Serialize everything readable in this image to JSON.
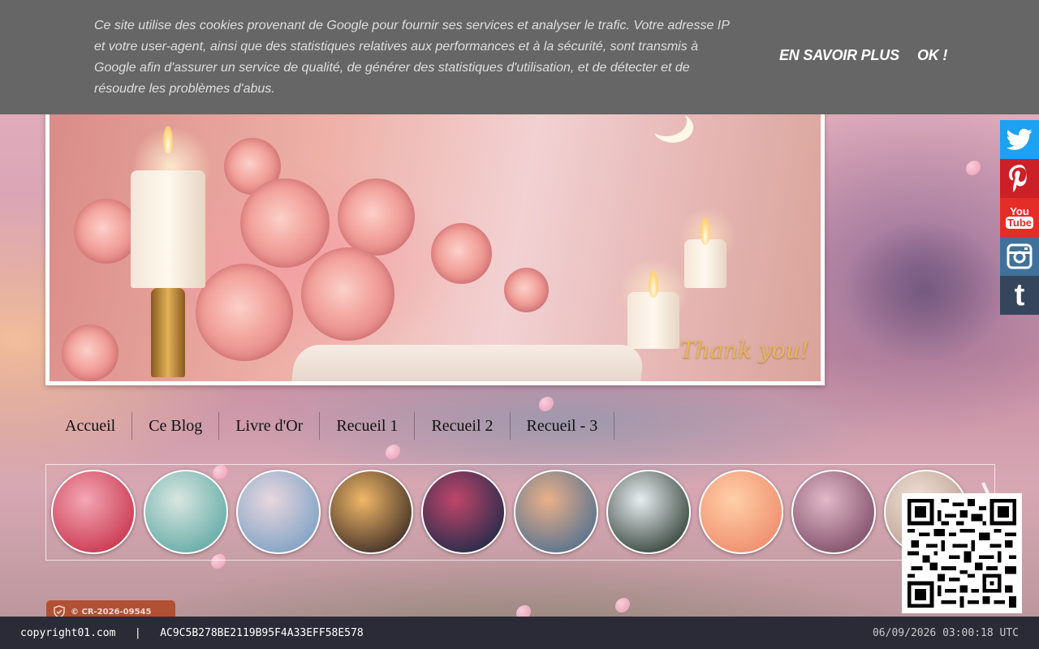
{
  "cookie_banner": {
    "text": "Ce site utilise des cookies provenant de Google pour fournir ses services et analyser le trafic. Votre adresse IP et votre user-agent, ainsi que des statistiques relatives aux performances et à la sécurité, sont transmis à Google afin d'assurer un service de qualité, de générer des statistiques d'utilisation, et de détecter et de résoudre les problèmes d'abus.",
    "learn_more_label": "EN SAVOIR PLUS",
    "ok_label": "OK !"
  },
  "banner": {
    "caption": "Thank you!"
  },
  "nav": {
    "items": [
      "Accueil",
      "Ce Blog",
      "Livre d'Or",
      "Recueil 1",
      "Recueil 2",
      "Recueil - 3"
    ]
  },
  "slider": {
    "thumbnails": [
      {
        "subject": "woman-in-red-dress",
        "colors": [
          "#f3a7b5",
          "#c8324a"
        ]
      },
      {
        "subject": "reflection-water",
        "colors": [
          "#d9e6e0",
          "#5fa9a4"
        ]
      },
      {
        "subject": "bird-on-branch",
        "colors": [
          "#e9d7df",
          "#7aa0c4"
        ]
      },
      {
        "subject": "couple-at-sunset",
        "colors": [
          "#f0b868",
          "#3b2a24"
        ]
      },
      {
        "subject": "flowers-doorway",
        "colors": [
          "#c0466a",
          "#1e2a4a"
        ]
      },
      {
        "subject": "woman-with-flower",
        "colors": [
          "#eab089",
          "#4f6f8f"
        ]
      },
      {
        "subject": "bride-in-garden",
        "colors": [
          "#e8eef0",
          "#2f3e36"
        ]
      },
      {
        "subject": "peach-rose",
        "colors": [
          "#ffd0a8",
          "#ef8a6a"
        ]
      },
      {
        "subject": "palm-reflection",
        "colors": [
          "#e2b9c8",
          "#7d4b66"
        ]
      },
      {
        "subject": "partial-thumbnail",
        "colors": [
          "#f1e3d8",
          "#b99a8e"
        ]
      }
    ]
  },
  "social": [
    {
      "name": "twitter",
      "color": "#1da1f2"
    },
    {
      "name": "pinterest",
      "color": "#cb2027"
    },
    {
      "name": "youtube",
      "color": "#e52d27",
      "label_top": "You",
      "label_bottom": "Tube"
    },
    {
      "name": "instagram",
      "color": "#3f729b"
    },
    {
      "name": "tumblr",
      "color": "#35465c",
      "label": "t"
    }
  ],
  "copyright_badge": {
    "text": "© CR-2026-09545"
  },
  "status_bar": {
    "site": "copyright01.com",
    "separator": "|",
    "hash": "AC9C5B278BE2119B95F4A33EFF58E578",
    "timestamp": "06/09/2026 03:00:18 UTC"
  },
  "colors": {
    "cookie_bg": "#666666",
    "status_bg": "#2b2b38",
    "badge_bg": "#b14a2a"
  }
}
